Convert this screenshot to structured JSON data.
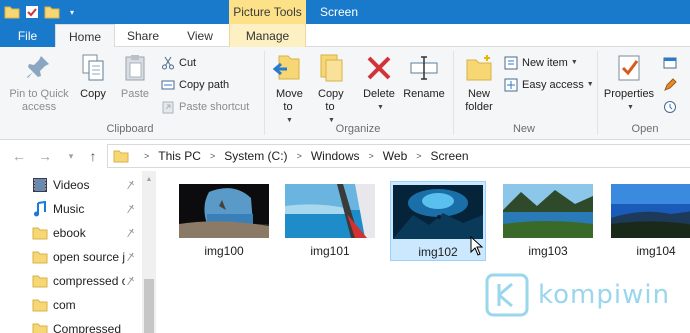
{
  "titlebar": {
    "context_tab": "Picture Tools",
    "window_title": "Screen"
  },
  "tabs": {
    "file": "File",
    "home": "Home",
    "share": "Share",
    "view": "View",
    "manage": "Manage"
  },
  "ribbon": {
    "clipboard": {
      "label": "Clipboard",
      "pin_to_quick_access": "Pin to Quick access",
      "copy": "Copy",
      "paste": "Paste",
      "cut": "Cut",
      "copy_path": "Copy path",
      "paste_shortcut": "Paste shortcut"
    },
    "organize": {
      "label": "Organize",
      "move_to": "Move to",
      "copy_to": "Copy to",
      "delete": "Delete",
      "rename": "Rename"
    },
    "new": {
      "label": "New",
      "new_folder": "New folder",
      "new_item": "New item",
      "easy_access": "Easy access"
    },
    "open": {
      "label": "Open",
      "properties": "Properties"
    }
  },
  "address": {
    "breadcrumb": [
      "This PC",
      "System (C:)",
      "Windows",
      "Web",
      "Screen"
    ]
  },
  "nav_pane": {
    "items": [
      {
        "label": "Videos",
        "icon": "videos-icon",
        "pinned": true
      },
      {
        "label": "Music",
        "icon": "music-icon",
        "pinned": true
      },
      {
        "label": "ebook",
        "icon": "folder-icon",
        "pinned": true
      },
      {
        "label": "open source j",
        "icon": "folder-icon",
        "pinned": true
      },
      {
        "label": "compressed c",
        "icon": "folder-icon",
        "pinned": true
      },
      {
        "label": "com",
        "icon": "folder-icon",
        "pinned": false
      },
      {
        "label": "Compressed",
        "icon": "folder-icon",
        "pinned": false
      }
    ]
  },
  "files": [
    {
      "name": "img100",
      "selected": false
    },
    {
      "name": "img101",
      "selected": false
    },
    {
      "name": "img102",
      "selected": true
    },
    {
      "name": "img103",
      "selected": false
    },
    {
      "name": "img104",
      "selected": false
    }
  ],
  "watermark": {
    "text": "kompiwin"
  },
  "colors": {
    "accent": "#1979ca",
    "context_tab": "#fce188",
    "selection": "#cce8ff"
  }
}
